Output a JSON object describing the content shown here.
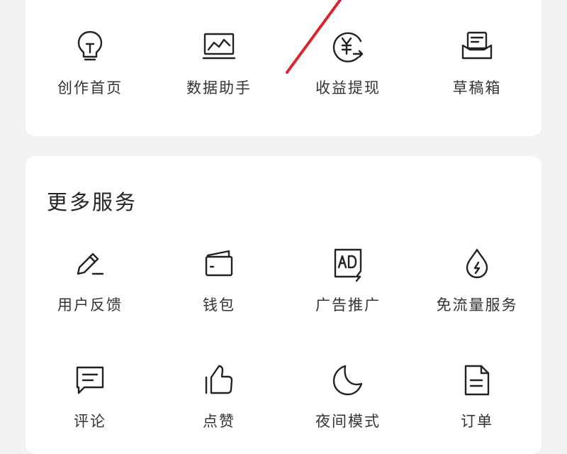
{
  "top_shortcuts": [
    {
      "label": "创作首页",
      "icon": "lightbulb-icon"
    },
    {
      "label": "数据助手",
      "icon": "chart-monitor-icon"
    },
    {
      "label": "收益提现",
      "icon": "yuan-withdraw-icon"
    },
    {
      "label": "草稿箱",
      "icon": "draft-box-icon"
    }
  ],
  "more_services": {
    "title": "更多服务",
    "row1": [
      {
        "label": "用户反馈",
        "icon": "pencil-feedback-icon"
      },
      {
        "label": "钱包",
        "icon": "wallet-icon"
      },
      {
        "label": "广告推广",
        "icon": "ad-icon"
      },
      {
        "label": "免流量服务",
        "icon": "water-drop-bolt-icon"
      }
    ],
    "row2": [
      {
        "label": "评论",
        "icon": "comment-icon"
      },
      {
        "label": "点赞",
        "icon": "thumbs-up-icon"
      },
      {
        "label": "夜间模式",
        "icon": "moon-icon"
      },
      {
        "label": "订单",
        "icon": "document-icon"
      }
    ]
  },
  "annotation": {
    "color": "#d9232d"
  }
}
